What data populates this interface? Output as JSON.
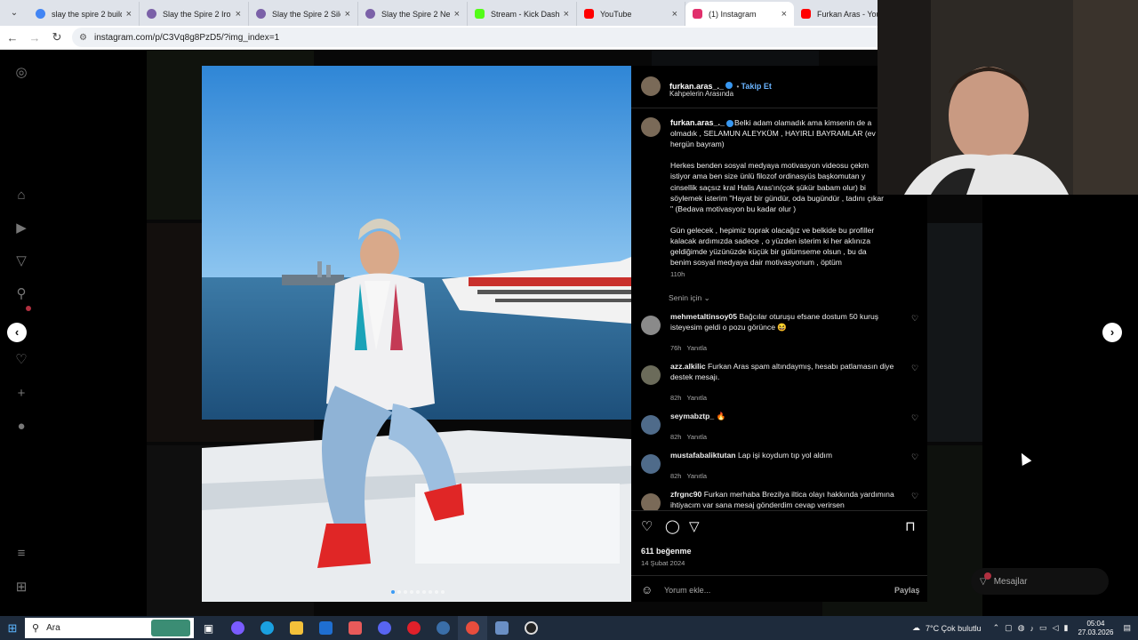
{
  "browser": {
    "tabs": [
      {
        "title": "slay the spire 2 build",
        "color": "#4285f4"
      },
      {
        "title": "Slay the Spire 2 Ironc",
        "color": "#7b61a8"
      },
      {
        "title": "Slay the Spire 2 Silen",
        "color": "#7b61a8"
      },
      {
        "title": "Slay the Spire 2 Necr",
        "color": "#7b61a8"
      },
      {
        "title": "Stream - Kick Dashbo",
        "color": "#53fc18"
      },
      {
        "title": "YouTube",
        "color": "#ff0000"
      },
      {
        "title": "(1) Instagram",
        "color": "#e1306c",
        "active": true
      },
      {
        "title": "Furkan Aras - YouTu",
        "color": "#ff0000"
      }
    ],
    "url": "instagram.com/p/C3Vq8g8PzD5/?img_index=1"
  },
  "post": {
    "username": "furkan.aras_._",
    "follow_label": "Takip Et",
    "location": "Kahpelerin Arasında",
    "caption_user": "furkan.aras_._",
    "caption": "Belki adam olamadık ama kimsenin de a olmadık , SELAMUN ALEYKÜM , HAYIRLI BAYRAMLAR (ev hergün bayram)\n\nHerkes benden sosyal medyaya motivasyon videosu çekm istiyor ama ben size ünlü filozof ordinasyüs başkomutan y cinsellik saçsız kral Halis Aras'ın(çok şükür babam olur) bi söylemek isterim \"Hayat bir gündür, oda bugündür , tadını çıkar \" (Bedava motivasyon bu kadar olur )\n\nGün gelecek , hepimiz toprak olacağız ve belkide bu profiller kalacak ardımızda sadece , o yüzden isterim ki her aklınıza geldiğimde yüzünüzde küçük bir gülümseme olsun , bu da benim sosyal medyaya dair motivasyonum , öptüm",
    "caption_time": "110h",
    "for_you_label": "Senin için",
    "likes": "611 beğenme",
    "date": "14 Şubat 2024",
    "comment_placeholder": "Yorum ekle...",
    "share_label": "Paylaş"
  },
  "comments": [
    {
      "user": "mehmetaltinsoy05",
      "text": "Bağcılar oturuşu efsane dostum 50 kuruş isteyesim geldi o pozu görünce 😆",
      "time": "76h",
      "reply": "Yanıtla"
    },
    {
      "user": "azz.alkilic",
      "text": "Furkan Aras spam altındaymış, hesabı patlamasın diye destek mesajı.",
      "time": "82h",
      "reply": "Yanıtla"
    },
    {
      "user": "seymabztp_",
      "text": "🔥",
      "time": "82h",
      "reply": "Yanıtla"
    },
    {
      "user": "mustafabaliktutan",
      "text": "Lap işi koydum tıp yol aldım",
      "time": "82h",
      "reply": "Yanıtla"
    },
    {
      "user": "zfrgnc90",
      "text": "Furkan merhaba Brezilya iltica olayı hakkında yardımına ihtiyacım var sana mesaj gönderdim cevap verirsen",
      "time": "",
      "reply": ""
    }
  ],
  "messages_label": "Mesajlar",
  "taskbar": {
    "search": "Ara",
    "weather": "7°C  Çok bulutlu",
    "time": "05:04",
    "date": "27.03.2026"
  }
}
